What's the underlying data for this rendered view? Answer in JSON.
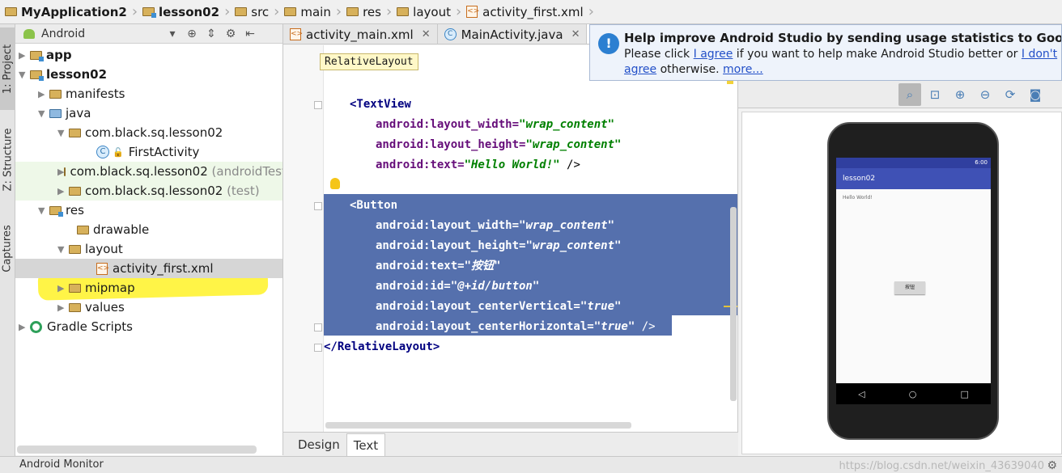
{
  "breadcrumbs": [
    {
      "label": "MyApplication2",
      "bold": true
    },
    {
      "label": "lesson02",
      "bold": true
    },
    {
      "label": "src"
    },
    {
      "label": "main"
    },
    {
      "label": "res"
    },
    {
      "label": "layout"
    },
    {
      "label": "activity_first.xml"
    }
  ],
  "left_strip": {
    "project_tab": "1: Project",
    "structure_tab": "Z: Structure",
    "captures_tab": "Captures"
  },
  "project_panel": {
    "view_mode": "Android",
    "tree": [
      {
        "label": "app",
        "bold": true
      },
      {
        "label": "lesson02",
        "bold": true
      },
      {
        "label": "manifests"
      },
      {
        "label": "java"
      },
      {
        "label": "com.black.sq.lesson02"
      },
      {
        "label": "FirstActivity"
      },
      {
        "label": "com.black.sq.lesson02",
        "suffix": "(androidTest)"
      },
      {
        "label": "com.black.sq.lesson02",
        "suffix": "(test)"
      },
      {
        "label": "res"
      },
      {
        "label": "drawable"
      },
      {
        "label": "layout"
      },
      {
        "label": "activity_first.xml"
      },
      {
        "label": "mipmap"
      },
      {
        "label": "values"
      },
      {
        "label": "Gradle Scripts"
      }
    ]
  },
  "editor_tabs": [
    {
      "label": "activity_main.xml"
    },
    {
      "label": "MainActivity.java"
    }
  ],
  "editor": {
    "breadcrumb_popup": "RelativeLayout",
    "lines": [
      {
        "parts": [
          {
            "t": "tag",
            "v": "<TextView"
          }
        ]
      },
      {
        "parts": [
          {
            "t": "attr",
            "v": "android:layout_width="
          },
          {
            "t": "val",
            "v": "\"wrap_content\""
          }
        ]
      },
      {
        "parts": [
          {
            "t": "attr",
            "v": "android:layout_height="
          },
          {
            "t": "val",
            "v": "\"wrap_content\""
          }
        ]
      },
      {
        "parts": [
          {
            "t": "attr",
            "v": "android:text="
          },
          {
            "t": "val",
            "v": "\"Hello World!\""
          },
          {
            "t": "plain",
            "v": " />"
          }
        ]
      },
      {
        "parts": [
          {
            "t": "tag",
            "v": "<Button"
          }
        ]
      },
      {
        "parts": [
          {
            "t": "attr",
            "v": "android:layout_width="
          },
          {
            "t": "val",
            "v": "\"wrap_content\""
          }
        ]
      },
      {
        "parts": [
          {
            "t": "attr",
            "v": "android:layout_height="
          },
          {
            "t": "val",
            "v": "\"wrap_content\""
          }
        ]
      },
      {
        "parts": [
          {
            "t": "attr",
            "v": "android:text="
          },
          {
            "t": "val",
            "v": "\"按钮\""
          }
        ]
      },
      {
        "parts": [
          {
            "t": "attr",
            "v": "android:id="
          },
          {
            "t": "val",
            "v": "\"@+id/button\""
          }
        ]
      },
      {
        "parts": [
          {
            "t": "attr",
            "v": "android:layout_centerVertical="
          },
          {
            "t": "val",
            "v": "\"true\""
          }
        ]
      },
      {
        "parts": [
          {
            "t": "attr",
            "v": "android:layout_centerHorizontal="
          },
          {
            "t": "val",
            "v": "\"true\""
          },
          {
            "t": "plain",
            "v": " />"
          }
        ]
      },
      {
        "parts": [
          {
            "t": "tag",
            "v": "</RelativeLayout>"
          }
        ]
      }
    ]
  },
  "bottom_tabs": {
    "design": "Design",
    "text": "Text"
  },
  "notification": {
    "title": "Help improve Android Studio by sending usage statistics to Google",
    "text_before": "Please click ",
    "agree": "I agree",
    "text_middle": " if you want to help make Android Studio better or ",
    "disagree": "I don't agree",
    "text_after": " otherwise. ",
    "more": "more..."
  },
  "preview": {
    "status_time": "6:00",
    "app_title": "lesson02",
    "hello_text": "Hello World!",
    "button_text": "按钮"
  },
  "status_bar": {
    "monitor": "Android Monitor",
    "watermark": "https://blog.csdn.net/weixin_43639040"
  },
  "colors": {
    "selection": "#5570ad",
    "highlight_marker": "#fff000",
    "app_bar": "#3f51b5"
  }
}
